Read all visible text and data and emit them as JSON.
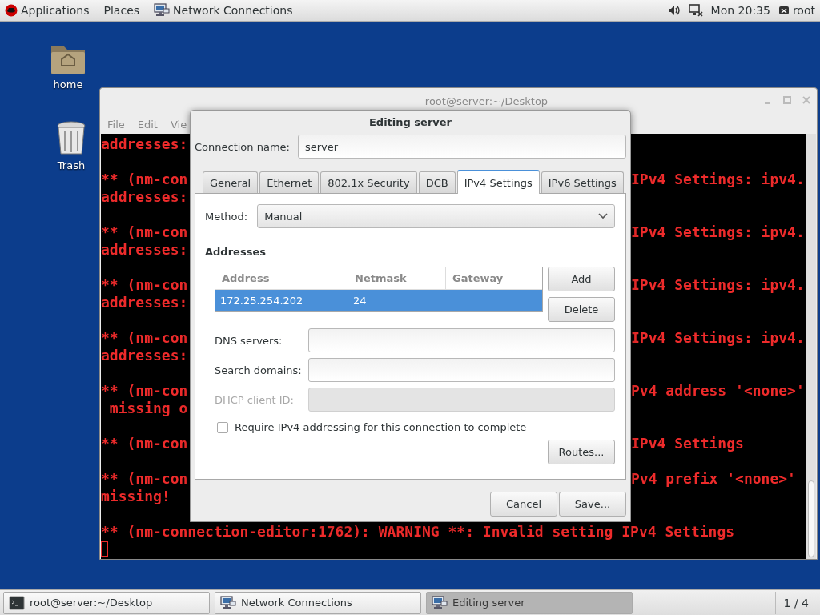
{
  "top_bar": {
    "menus": [
      {
        "label": "Applications",
        "kind": "logo"
      },
      {
        "label": "Places",
        "kind": "plain"
      }
    ],
    "active_app": "Network Connections",
    "clock": "Mon 20:35",
    "user": "root"
  },
  "desktop_icons": [
    {
      "kind": "folder",
      "label": "home"
    },
    {
      "kind": "trash",
      "label": "Trash"
    }
  ],
  "terminal": {
    "title": "root@server:~/Desktop",
    "menus": [
      "File",
      "Edit",
      "Vie"
    ],
    "lines": [
      {
        "kind": "text",
        "left": "addresses:"
      },
      {
        "kind": "blank"
      },
      {
        "kind": "text",
        "left": "** (nm-con",
        "right": "IPv4 Settings: ipv4."
      },
      {
        "kind": "text",
        "left": "addresses:"
      },
      {
        "kind": "blank"
      },
      {
        "kind": "text",
        "left": "** (nm-con",
        "right": "IPv4 Settings: ipv4."
      },
      {
        "kind": "text",
        "left": "addresses:"
      },
      {
        "kind": "blank"
      },
      {
        "kind": "text",
        "left": "** (nm-con",
        "right": "IPv4 Settings: ipv4."
      },
      {
        "kind": "text",
        "left": "addresses:"
      },
      {
        "kind": "blank"
      },
      {
        "kind": "text",
        "left": "** (nm-con",
        "right": "IPv4 Settings: ipv4."
      },
      {
        "kind": "text",
        "left": "addresses:"
      },
      {
        "kind": "blank"
      },
      {
        "kind": "text",
        "left": "** (nm-con",
        "right": "Pv4 address '<none>'"
      },
      {
        "kind": "text",
        "left": " missing o"
      },
      {
        "kind": "blank"
      },
      {
        "kind": "text",
        "left": "** (nm-con",
        "right": "IPv4 Settings"
      },
      {
        "kind": "blank"
      },
      {
        "kind": "text",
        "left": "** (nm-con",
        "right": "Pv4 prefix '<none>'"
      },
      {
        "kind": "text",
        "left": "missing!"
      },
      {
        "kind": "blank"
      },
      {
        "kind": "text",
        "left": "** (nm-connection-editor:1762): WARNING **: Invalid setting IPv4 Settings"
      },
      {
        "kind": "cursor"
      }
    ]
  },
  "dialog": {
    "title": "Editing server",
    "connection_name": {
      "label": "Connection name:",
      "value": "server"
    },
    "tabs": [
      {
        "label": "General",
        "selected": false
      },
      {
        "label": "Ethernet",
        "selected": false
      },
      {
        "label": "802.1x Security",
        "selected": false
      },
      {
        "label": "DCB",
        "selected": false
      },
      {
        "label": "IPv4 Settings",
        "selected": true
      },
      {
        "label": "IPv6 Settings",
        "selected": false
      }
    ],
    "method": {
      "label": "Method:",
      "value": "Manual"
    },
    "addresses": {
      "heading": "Addresses",
      "columns": [
        "Address",
        "Netmask",
        "Gateway"
      ],
      "rows": [
        {
          "cells": [
            "172.25.254.202",
            "24"
          ],
          "selected": true
        }
      ],
      "buttons": [
        "Add",
        "Delete"
      ]
    },
    "fields": [
      {
        "label": "DNS servers:",
        "disabled": false
      },
      {
        "label": "Search domains:",
        "disabled": false
      },
      {
        "label": "DHCP client ID:",
        "disabled": true
      }
    ],
    "require": {
      "label": "Require IPv4 addressing for this connection to complete",
      "checked": false
    },
    "routes_button": "Routes...",
    "buttons": [
      "Cancel",
      "Save..."
    ]
  },
  "taskbar": {
    "items": [
      {
        "label": "root@server:~/Desktop",
        "kind": "terminal",
        "selected": false
      },
      {
        "label": "Network Connections",
        "kind": "network",
        "selected": false
      },
      {
        "label": "Editing server",
        "kind": "network",
        "selected": true
      }
    ],
    "workspace": "1 / 4"
  }
}
